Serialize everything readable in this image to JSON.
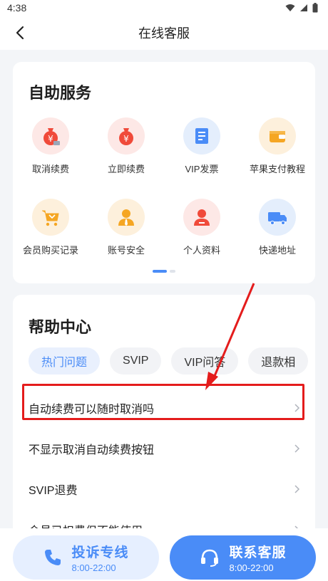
{
  "status_bar": {
    "time": "4:38"
  },
  "nav": {
    "title": "在线客服"
  },
  "self_service": {
    "title": "自助服务",
    "items": [
      {
        "label": "取消续费",
        "icon": "money-bag-icon"
      },
      {
        "label": "立即续费",
        "icon": "money-bag-icon"
      },
      {
        "label": "VIP发票",
        "icon": "invoice-icon"
      },
      {
        "label": "苹果支付教程",
        "icon": "wallet-icon"
      },
      {
        "label": "会员购买记录",
        "icon": "cart-icon"
      },
      {
        "label": "账号安全",
        "icon": "user-tie-icon"
      },
      {
        "label": "个人资料",
        "icon": "user-icon"
      },
      {
        "label": "快递地址",
        "icon": "truck-icon"
      }
    ]
  },
  "help_center": {
    "title": "帮助中心",
    "tabs": [
      "热门问题",
      "SVIP",
      "VIP问答",
      "退款相"
    ],
    "questions": [
      "自动续费可以随时取消吗",
      "不显示取消自动续费按钮",
      "SVIP退费",
      "会员已扣费但不能使用"
    ]
  },
  "bottom": {
    "complaint": {
      "title": "投诉专线",
      "hours": "8:00-22:00"
    },
    "contact": {
      "title": "联系客服",
      "hours": "8:00-22:00"
    }
  },
  "colors": {
    "accent": "#4a8cf7",
    "annotation_red": "#e41c1c"
  }
}
